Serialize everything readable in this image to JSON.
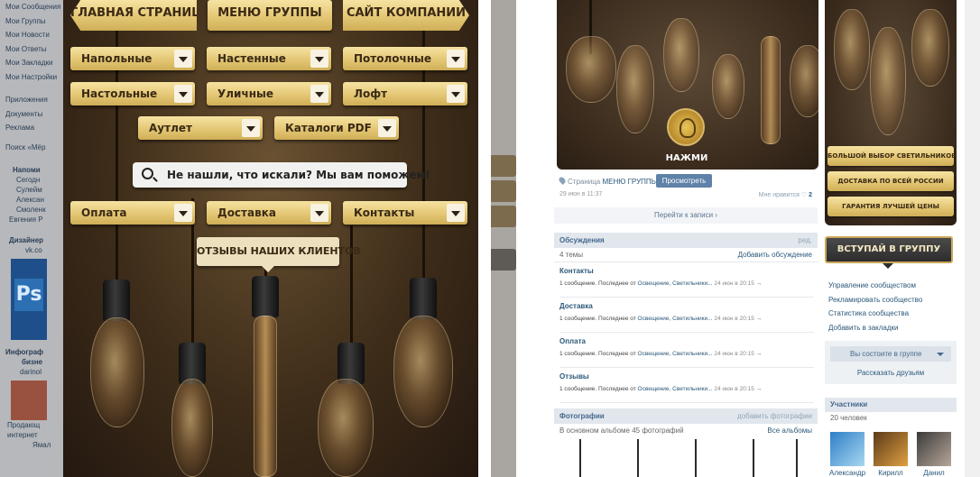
{
  "left_sidebar": {
    "nav": [
      "Мои Сообщения",
      "Мои Группы",
      "Мои Новости",
      "Мои Ответы",
      "Мои Закладки",
      "Мои Настройки"
    ],
    "nav2": [
      "Приложения",
      "Документы",
      "Реклама"
    ],
    "search_promo": "Поиск «Мёр",
    "reminder_title": "Напоми",
    "reminder_lines": [
      "Сегодн",
      "Сулейм",
      "Алексан",
      "Смоленк",
      "Евгения Р"
    ],
    "ad1_title": "Дизайнер",
    "ad1_sub": "vk.co",
    "ad2_title": "Инфограф",
    "ad2_sub1": "бизне",
    "ad2_sub2": "darinol",
    "ad3_lines": [
      "Продающ",
      "интернет",
      "Ямал"
    ]
  },
  "menu": {
    "top_buttons": [
      "ГЛАВНАЯ СТРАНИЦА",
      "МЕНЮ ГРУППЫ",
      "САЙТ КОМПАНИИ"
    ],
    "dropdowns_row1": [
      "Напольные",
      "Настенные",
      "Потолочные"
    ],
    "dropdowns_row2": [
      "Настольные",
      "Уличные",
      "Лофт"
    ],
    "dropdowns_row3": [
      "Аутлет",
      "Каталоги PDF"
    ],
    "search_text": "Не нашли, что искали? Мы вам поможем!",
    "dropdowns_row4": [
      "Оплата",
      "Доставка",
      "Контакты"
    ],
    "reviews": "ОТЗЫВЫ НАШИХ КЛИЕНТОВ"
  },
  "main": {
    "press_label": "НАЖМИ",
    "page_prefix": "Страница",
    "page_name": "МЕНЮ ГРУППЫ",
    "view_button": "Просмотреть",
    "date": "29 июн в 11:37",
    "likes_label": "Мне нравится",
    "likes_count": "2",
    "goto_posts": "Перейти к записи ›",
    "discussions": {
      "title": "Обсуждения",
      "edit": "ред.",
      "count": "4 темы",
      "add": "Добавить обсуждение",
      "topics": [
        {
          "title": "Контакты",
          "pre": "1 сообщение. Последнее от",
          "author": "Освещение, Светильники...",
          "when": "24 июн в 20:15",
          "arrow": "→"
        },
        {
          "title": "Доставка",
          "pre": "1 сообщение. Последнее от",
          "author": "Освещение, Светильники...",
          "when": "24 июн в 20:15",
          "arrow": "→"
        },
        {
          "title": "Оплата",
          "pre": "1 сообщение. Последнее от",
          "author": "Освещение, Светильники...",
          "when": "24 июн в 20:15",
          "arrow": "→"
        },
        {
          "title": "Отзывы",
          "pre": "1 сообщение. Последнее от",
          "author": "Освещение, Светильники...",
          "when": "24 июн в 20:15",
          "arrow": "→"
        }
      ]
    },
    "photos": {
      "title": "Фотографии",
      "add": "добавить фотографии",
      "album": "В основном альбоме 45 фотографий",
      "all": "Все альбомы"
    }
  },
  "right": {
    "banner_buttons": [
      "БОЛЬШОЙ ВЫБОР СВЕТИЛЬНИКОВ",
      "ДОСТАВКА ПО ВСЕЙ РОССИИ",
      "ГАРАНТИЯ ЛУЧШЕЙ ЦЕНЫ"
    ],
    "join": "ВСТУПАЙ В ГРУППУ",
    "links": [
      "Управление сообществом",
      "Рекламировать сообщество",
      "Статистика сообщества",
      "Добавить в закладки"
    ],
    "member_status": "Вы состоите в группе",
    "invite": "Рассказать друзьям",
    "participants_title": "Участники",
    "participants_count": "20 человек",
    "members": [
      "Александр",
      "Кирилл",
      "Данил"
    ]
  },
  "colors": {
    "gold": "#e2c471",
    "vk_link": "#2b587a",
    "vk_head": "#e1e7ed"
  }
}
